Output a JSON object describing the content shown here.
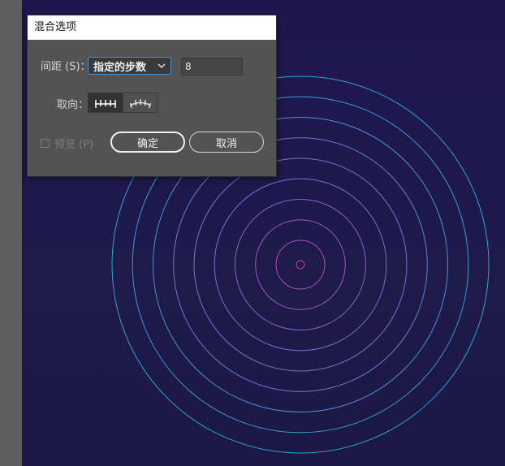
{
  "dialog": {
    "title": "混合选项",
    "spacing_label": "间距 (S)：",
    "spacing_option": "指定的步数",
    "steps_value": "8",
    "orientation_label": "取向：",
    "preview_label": "预览 (P)",
    "ok_label": "确定",
    "cancel_label": "取消"
  },
  "artwork": {
    "ring_count": 10,
    "inner_color": "#c040c0",
    "outer_color": "#2aa8d8"
  }
}
